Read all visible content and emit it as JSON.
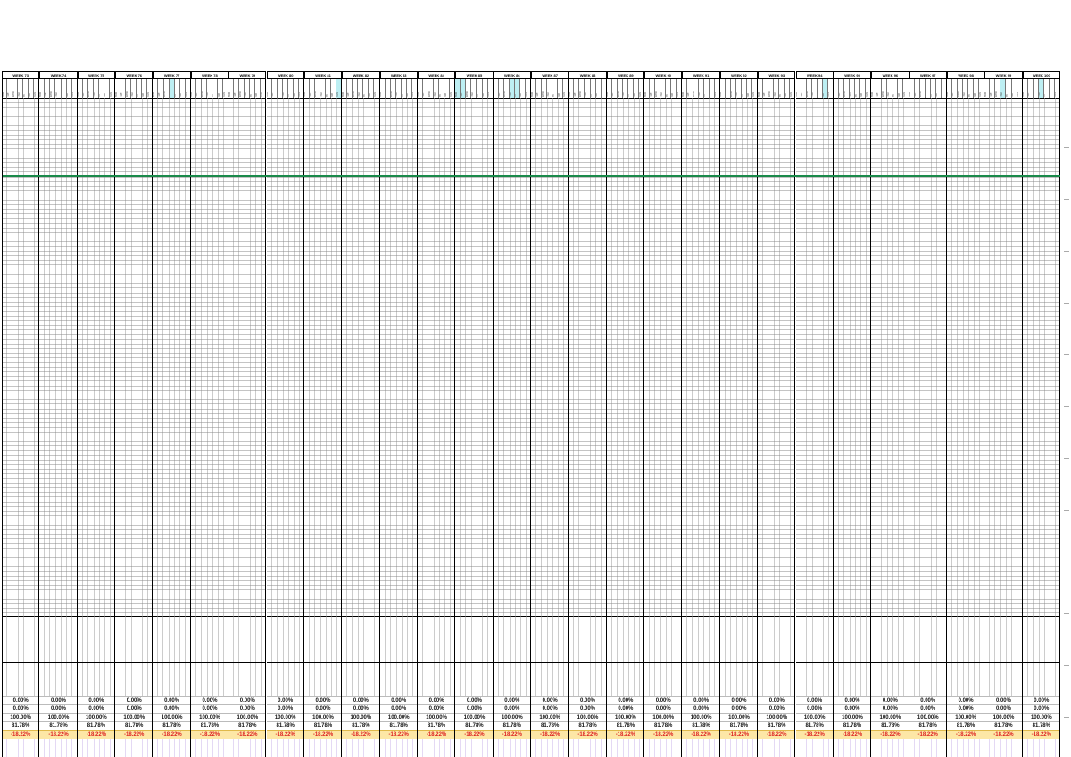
{
  "weeks": [
    {
      "label": "WEEK 73",
      "days": [
        "Mon",
        "Tue",
        "Wed",
        "Thu",
        "Fri",
        "Sat",
        "Sun"
      ]
    },
    {
      "label": "WEEK 74",
      "days": [
        "Mon",
        "Tue",
        "Wed",
        "Thu",
        "Fri",
        "Sat",
        "Sun"
      ]
    },
    {
      "label": "WEEK 75",
      "days": [
        "Mon",
        "Tue",
        "Wed",
        "Thu",
        "Fri",
        "Sat",
        "Sun"
      ]
    },
    {
      "label": "WEEK 76",
      "days": [
        "Mon",
        "Tue",
        "Wed",
        "Thu",
        "Fri",
        "Sat",
        "Sun"
      ]
    },
    {
      "label": "WEEK 77",
      "days": [
        "Mon",
        "Tue",
        "Wed",
        "Thu",
        "Fri",
        "Sat",
        "Sun"
      ]
    },
    {
      "label": "WEEK 78",
      "days": [
        "Mon",
        "Tue",
        "Wed",
        "Thu",
        "Fri",
        "Sat",
        "Sun"
      ]
    },
    {
      "label": "WEEK 79",
      "days": [
        "Mon",
        "Tue",
        "Wed",
        "Thu",
        "Fri",
        "Sat",
        "Sun"
      ]
    },
    {
      "label": "WEEK 80",
      "days": [
        "Mon",
        "Tue",
        "Wed",
        "Thu",
        "Fri",
        "Sat",
        "Sun"
      ]
    },
    {
      "label": "WEEK 81",
      "days": [
        "Mon",
        "Tue",
        "Wed",
        "Thu",
        "Fri",
        "Sat",
        "Sun"
      ]
    },
    {
      "label": "WEEK 82",
      "days": [
        "Mon",
        "Tue",
        "Wed",
        "Thu",
        "Fri",
        "Sat",
        "Sun"
      ]
    },
    {
      "label": "WEEK 83",
      "days": [
        "Mon",
        "Tue",
        "Wed",
        "Thu",
        "Fri",
        "Sat",
        "Sun"
      ]
    },
    {
      "label": "WEEK 84",
      "days": [
        "Mon",
        "Tue",
        "Wed",
        "Thu",
        "Fri",
        "Sat",
        "Sun"
      ]
    },
    {
      "label": "WEEK 85",
      "days": [
        "Mon",
        "Tue",
        "Wed",
        "Thu",
        "Fri",
        "Sat",
        "Sun"
      ]
    },
    {
      "label": "WEEK 86",
      "days": [
        "Mon",
        "Tue",
        "Wed",
        "Thu",
        "Fri",
        "Sat",
        "Sun"
      ]
    },
    {
      "label": "WEEK 87",
      "days": [
        "Mon",
        "Tue",
        "Wed",
        "Thu",
        "Fri",
        "Sat",
        "Sun"
      ]
    },
    {
      "label": "WEEK 88",
      "days": [
        "Mon",
        "Tue",
        "Wed",
        "Thu",
        "Fri",
        "Sat",
        "Sun"
      ]
    },
    {
      "label": "WEEK 89",
      "days": [
        "Mon",
        "Tue",
        "Wed",
        "Thu",
        "Fri",
        "Sat",
        "Sun"
      ]
    },
    {
      "label": "WEEK 90",
      "days": [
        "Mon",
        "Tue",
        "Wed",
        "Thu",
        "Fri",
        "Sat",
        "Sun"
      ]
    },
    {
      "label": "WEEK 91",
      "days": [
        "Mon",
        "Tue",
        "Wed",
        "Thu",
        "Fri",
        "Sat",
        "Sun"
      ]
    },
    {
      "label": "WEEK 92",
      "days": [
        "Mon",
        "Tue",
        "Wed",
        "Thu",
        "Fri",
        "Sat",
        "Sun"
      ]
    },
    {
      "label": "WEEK 93",
      "days": [
        "Mon",
        "Tue",
        "Wed",
        "Thu",
        "Fri",
        "Sat",
        "Sun"
      ]
    },
    {
      "label": "WEEK 94",
      "days": [
        "Mon",
        "Tue",
        "Wed",
        "Thu",
        "Fri",
        "Sat",
        "Sun"
      ]
    },
    {
      "label": "WEEK 95",
      "days": [
        "Mon",
        "Tue",
        "Wed",
        "Thu",
        "Fri",
        "Sat",
        "Sun"
      ]
    },
    {
      "label": "WEEK 96",
      "days": [
        "Mon",
        "Tue",
        "Wed",
        "Thu",
        "Fri",
        "Sat",
        "Sun"
      ]
    },
    {
      "label": "WEEK 97",
      "days": [
        "Mon",
        "Tue",
        "Wed",
        "Thu",
        "Fri",
        "Sat",
        "Sun"
      ]
    },
    {
      "label": "WEEK 98",
      "days": [
        "Mon",
        "Tue",
        "Wed",
        "Thu",
        "Fri",
        "Sat",
        "Sun"
      ]
    },
    {
      "label": "WEEK 99",
      "days": [
        "Mon",
        "Tue",
        "Wed",
        "Thu",
        "Fri",
        "Sat",
        "Sun"
      ]
    },
    {
      "label": "WEEK 100",
      "days": [
        "Mon",
        "Tue",
        "Wed",
        "Thu",
        "Fri",
        "Sat",
        "Sun"
      ]
    }
  ],
  "highlighted_days": [
    [
      4,
      3
    ],
    [
      8,
      6
    ],
    [
      12,
      0
    ],
    [
      12,
      1
    ],
    [
      13,
      3
    ],
    [
      13,
      4
    ],
    [
      21,
      5
    ],
    [
      26,
      3
    ],
    [
      27,
      3
    ]
  ],
  "summary": {
    "row1": "0.00%",
    "row2": "0.00%",
    "row3": "100.00%",
    "row4": "81.78%",
    "row5": "-18.22%"
  },
  "colors": {
    "baseline": "#1a8a4a",
    "highlight": "#bdeff3",
    "negative_text": "#dd2222",
    "negative_bg": "#fde7a6",
    "bottom_lines": "#c9b3e8"
  }
}
